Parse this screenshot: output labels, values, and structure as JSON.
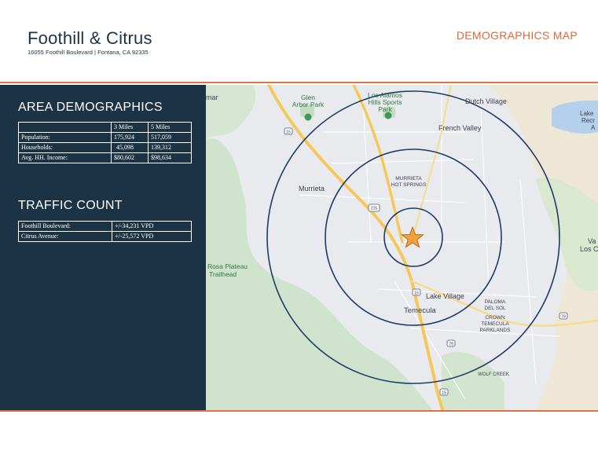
{
  "header": {
    "title": "Foothill & Citrus",
    "address": "16055 Foothill Boulevard | Fontana, CA 92335",
    "section_label": "DEMOGRAPHICS MAP"
  },
  "demographics": {
    "heading": "AREA DEMOGRAPHICS",
    "columns": [
      "",
      "3 Miles",
      "5 Miles"
    ],
    "rows": [
      {
        "label": "Population:",
        "v3": "175,924",
        "v5": "517,059"
      },
      {
        "label": "Households:",
        "v3": "45,098",
        "v5": "139,312"
      },
      {
        "label": "Avg. HH. Income:",
        "v3": "$80,602",
        "v5": "$98,634"
      }
    ]
  },
  "traffic": {
    "heading": "TRAFFIC COUNT",
    "rows": [
      {
        "label": "Foothill Boulevard:",
        "value": "+/-34,231 VPD"
      },
      {
        "label": "Citrus Avenue:",
        "value": "+/-25,572 VPD"
      }
    ]
  },
  "map": {
    "labels": {
      "mar": "mar",
      "glen1": "Glen",
      "glen2": "Arbor Park",
      "losalamos1": "Los Alamos",
      "losalamos2": "Hills Sports",
      "losalamos3": "Park",
      "dutch": "Dutch Village",
      "french": "French Valley",
      "lake1": "Lake",
      "lake2": "Recr",
      "lake3": "A",
      "murrieta_hot1": "MURRIETA",
      "murrieta_hot2": "HOT SPRINGS",
      "murrieta": "Murrieta",
      "rosa1": "Rosa Plateau",
      "rosa2": "Trailhead",
      "va1": "Va",
      "va2": "Los C",
      "lake_village": "Lake Village",
      "temecula": "Temecula",
      "paloma1": "PALOMA",
      "paloma2": "DEL SOL",
      "crown1": "CROWN",
      "crown2": "TEMECULA",
      "crown3": "PARKLANDS",
      "wolf": "WOLF CREEK",
      "shield15": "15",
      "shield215": "215",
      "shield15b": "15",
      "shield79": "79",
      "shield79b": "79",
      "shield15c": "15"
    },
    "colors": {
      "ring": "#1f3a68",
      "marker": "#f2a03d",
      "panel": "#1b3344",
      "accent": "#e27046"
    },
    "radius_rings": 3
  }
}
